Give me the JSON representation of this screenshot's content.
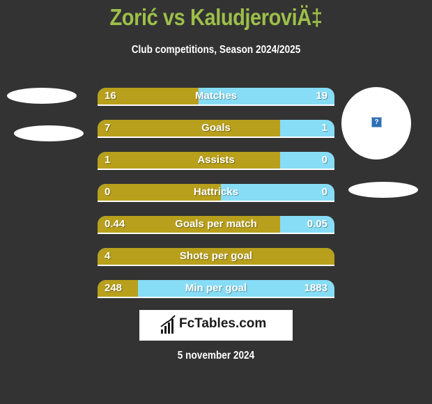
{
  "header": {
    "title": "Zorić vs KaludjeroviÄ‡",
    "subtitle": "Club competitions, Season 2024/2025"
  },
  "colors": {
    "background": "#333333",
    "title": "#9cbf49",
    "left_bar": "#b8a01c",
    "right_bar": "#87ddf6"
  },
  "stats": [
    {
      "label": "Matches",
      "left": "16",
      "right": "19",
      "left_share": 0.426
    },
    {
      "label": "Goals",
      "left": "7",
      "right": "1",
      "left_share": 0.77
    },
    {
      "label": "Assists",
      "left": "1",
      "right": "0",
      "left_share": 0.77
    },
    {
      "label": "Hattricks",
      "left": "0",
      "right": "0",
      "left_share": 0.52
    },
    {
      "label": "Goals per match",
      "left": "0.44",
      "right": "0.05",
      "left_share": 0.77
    },
    {
      "label": "Shots per goal",
      "left": "4",
      "right": "",
      "left_share": 1.0
    },
    {
      "label": "Min per goal",
      "left": "248",
      "right": "1883",
      "left_share": 0.17
    }
  ],
  "player_image": {
    "icon": "question-mark-icon",
    "glyph": "?"
  },
  "logo": {
    "text": "FcTables.com",
    "icon": "bar-chart-icon"
  },
  "footer": {
    "date": "5 november 2024"
  }
}
